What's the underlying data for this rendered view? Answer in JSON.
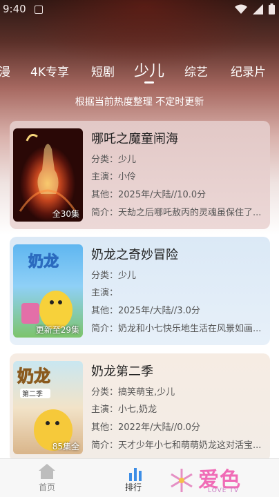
{
  "status_bar": {
    "time": "9:40"
  },
  "tabs": [
    {
      "label": "漫"
    },
    {
      "label": "4K专享"
    },
    {
      "label": "短剧"
    },
    {
      "label": "少儿",
      "active": true
    },
    {
      "label": "综艺"
    },
    {
      "label": "纪录片"
    }
  ],
  "subtitle": "根据当前热度整理 不定时更新",
  "cards": [
    {
      "title": "哪吒之魔童闹海",
      "category": "分类：少儿",
      "cast": "主演：小伶",
      "other": "其他：2025年/大陆//10.0分",
      "intro": "简介：天劫之后哪吒敖丙的灵魂虽保住了...",
      "badge": "全30集"
    },
    {
      "title": "奶龙之奇妙冒险",
      "category": "分类：少儿",
      "cast": "主演：",
      "other": "其他：2025年/大陆//3.0分",
      "intro": "简介：奶龙和小七快乐地生活在风景如画...",
      "badge": "更新至29集"
    },
    {
      "title": "奶龙第二季",
      "category": "分类：搞笑萌宝,少儿",
      "cast": "主演：小七,奶龙",
      "other": "其他：2022年/大陆//0.0分",
      "intro": "简介：天才少年小七和萌萌奶龙这对活宝...",
      "badge": "85集全"
    }
  ],
  "bottom_nav": {
    "home": "首页",
    "rank": "排行"
  },
  "watermark": {
    "text": "爱色",
    "sub": "LOVE TV"
  }
}
